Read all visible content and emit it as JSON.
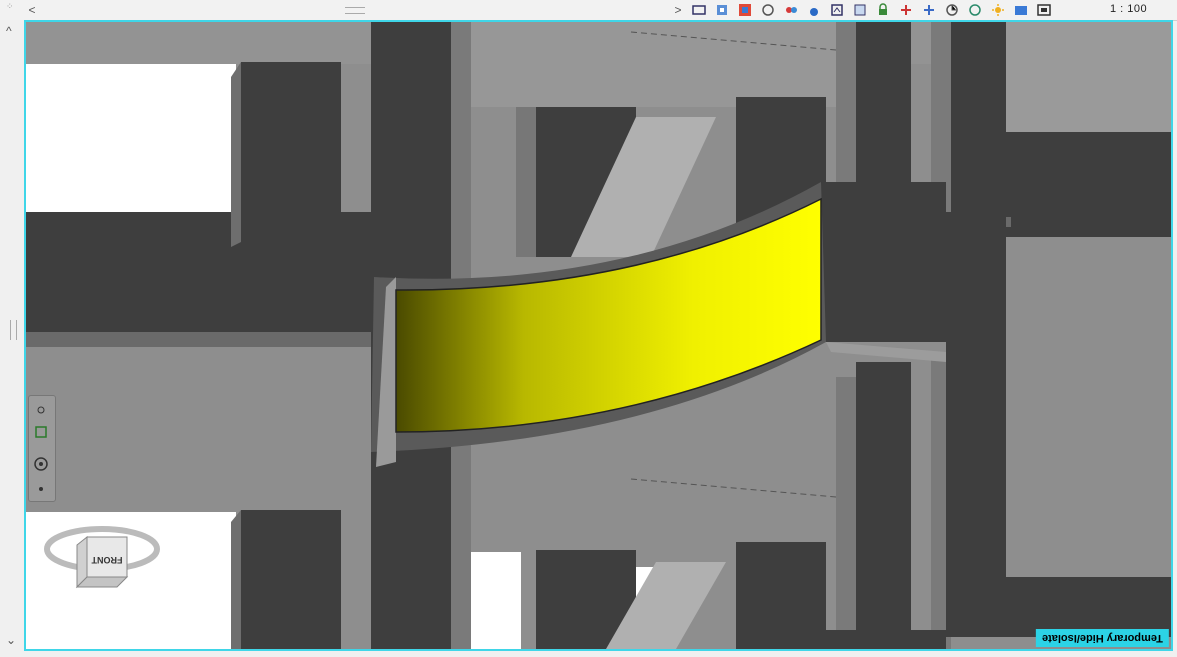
{
  "toolbar": {
    "scale": "1 : 100",
    "icons": [
      "scale-icon",
      "detail-level-icon",
      "visual-style-icon",
      "sun-path-icon",
      "shadows-icon",
      "render-icon",
      "crop-view-icon",
      "show-crop-icon",
      "lock-3d-icon",
      "temporary-hide-icon",
      "reveal-hidden-icon",
      "worksharing-icon",
      "design-options-icon",
      "analytical-model-icon",
      "highlight-displacement-icon"
    ]
  },
  "viewport": {
    "mode_banner": "Temporary Hide/Isolate",
    "border_color": "#3fd6e8",
    "highlight_color": "#ffff00"
  },
  "viewcube": {
    "face": "FRONT"
  }
}
